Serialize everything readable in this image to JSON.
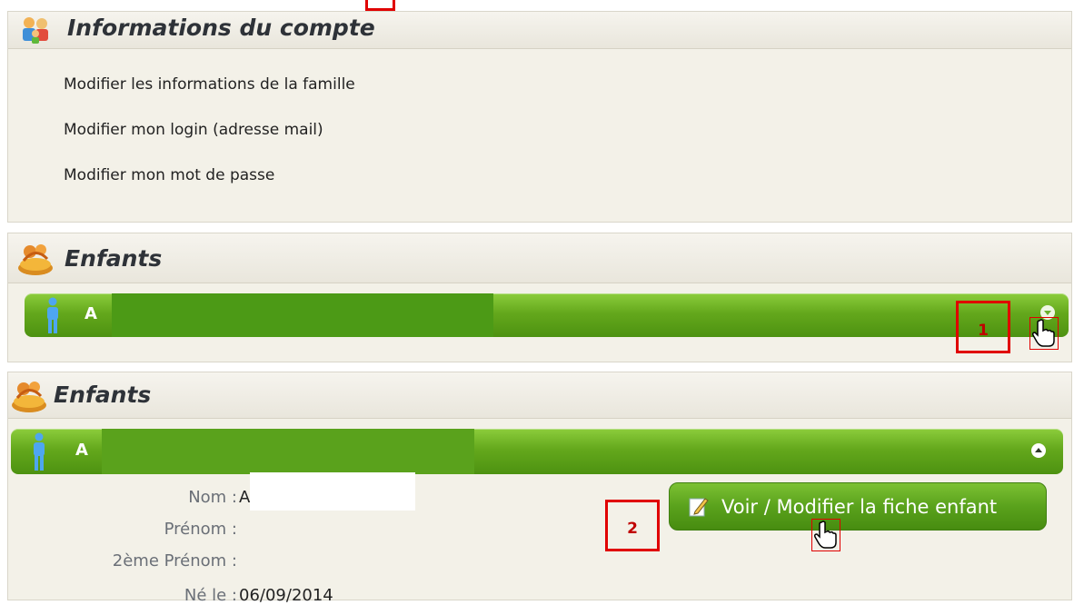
{
  "account": {
    "title": "Informations du compte",
    "links": [
      "Modifier les informations de la famille",
      "Modifier mon login (adresse mail)",
      "Modifier mon mot de passe"
    ]
  },
  "children_collapsed": {
    "title": "Enfants",
    "child_name": "A"
  },
  "children_expanded": {
    "title": "Enfants",
    "child_name": "A",
    "fields": {
      "nom_label": "Nom :",
      "nom_value": "A",
      "prenom_label": "Prénom :",
      "prenom2_label": "2ème Prénom :",
      "ne_le_label": "Né le :",
      "ne_le_value": "06/09/2014"
    },
    "fiche_button_label": "Voir / Modifier la fiche enfant"
  },
  "annotations": {
    "step1": "1",
    "step2": "2"
  },
  "colors": {
    "accent_green": "#5aa21c",
    "annotation_red": "#e00000",
    "panel_bg": "#f3f1e8"
  },
  "icons": [
    "family-icon",
    "children-icon",
    "child-figure-icon",
    "expand-icon",
    "collapse-icon",
    "edit-pencil-icon",
    "hand-cursor-icon"
  ]
}
